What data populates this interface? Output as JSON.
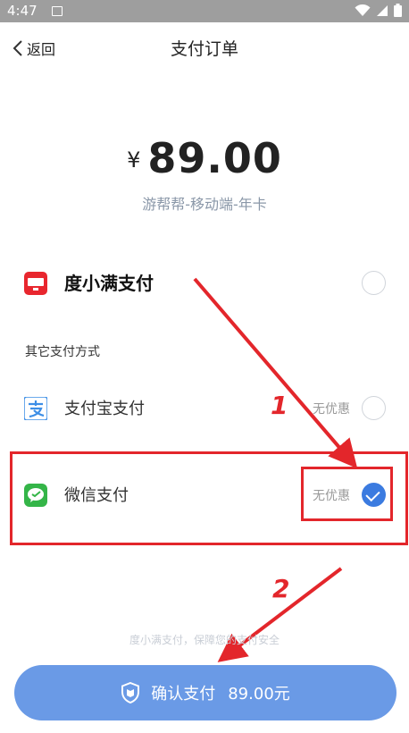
{
  "status_bar": {
    "time": "4:47"
  },
  "nav": {
    "back_label": "返回",
    "title": "支付订单"
  },
  "order": {
    "currency": "¥",
    "amount": "89.00",
    "product": "游帮帮-移动端-年卡"
  },
  "payment": {
    "primary": {
      "label": "度小满支付",
      "icon_text": "度小满",
      "selected": false
    },
    "section_label": "其它支付方式",
    "alipay": {
      "label": "支付宝支付",
      "discount": "无优惠",
      "selected": false
    },
    "wechat": {
      "label": "微信支付",
      "discount": "无优惠",
      "selected": true
    }
  },
  "annotations": {
    "step1": "1",
    "step2": "2"
  },
  "footer": {
    "note": "度小满支付，保障您的支付安全",
    "confirm_label": "确认支付",
    "confirm_amount": "89.00元"
  },
  "colors": {
    "accent": "#3b7be0",
    "button": "#6a9ae6",
    "annotation": "#e3262b"
  }
}
